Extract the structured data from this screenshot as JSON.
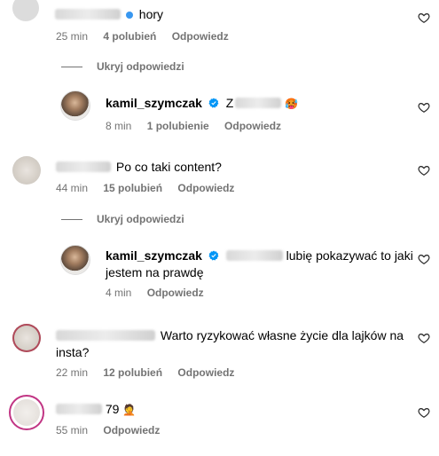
{
  "comments": [
    {
      "username_blurred": "zojaskabis",
      "text": "hory",
      "time": "25 min",
      "likes": "4 polubień",
      "reply_label": "Odpowiedz",
      "hide_replies_label": "Ukryj odpowiedzi",
      "reply": {
        "username": "kamil_szymczak",
        "text_blurred": "Z",
        "time": "8 min",
        "likes": "1 polubienie",
        "reply_label": "Odpowiedz"
      }
    },
    {
      "text": "Po co taki content?",
      "time": "44 min",
      "likes": "15 polubień",
      "reply_label": "Odpowiedz",
      "hide_replies_label": "Ukryj odpowiedzi",
      "reply": {
        "username": "kamil_szymczak",
        "text_line1": "lubię pokazywać to jaki",
        "text_line2": "jestem na prawdę",
        "time": "4 min",
        "reply_label": "Odpowiedz"
      }
    },
    {
      "text_line1": "Warto ryzykować własne życie dla lajków na",
      "text_line2": "insta?",
      "time": "22 min",
      "likes": "12 polubień",
      "reply_label": "Odpowiedz"
    },
    {
      "username_suffix": "79",
      "time": "55 min",
      "reply_label": "Odpowiedz"
    }
  ],
  "icons": {
    "heart": "heart-outline-icon",
    "verified": "verified-badge-icon",
    "verified_color": "#0095f6",
    "text_secondary": "#737373"
  }
}
